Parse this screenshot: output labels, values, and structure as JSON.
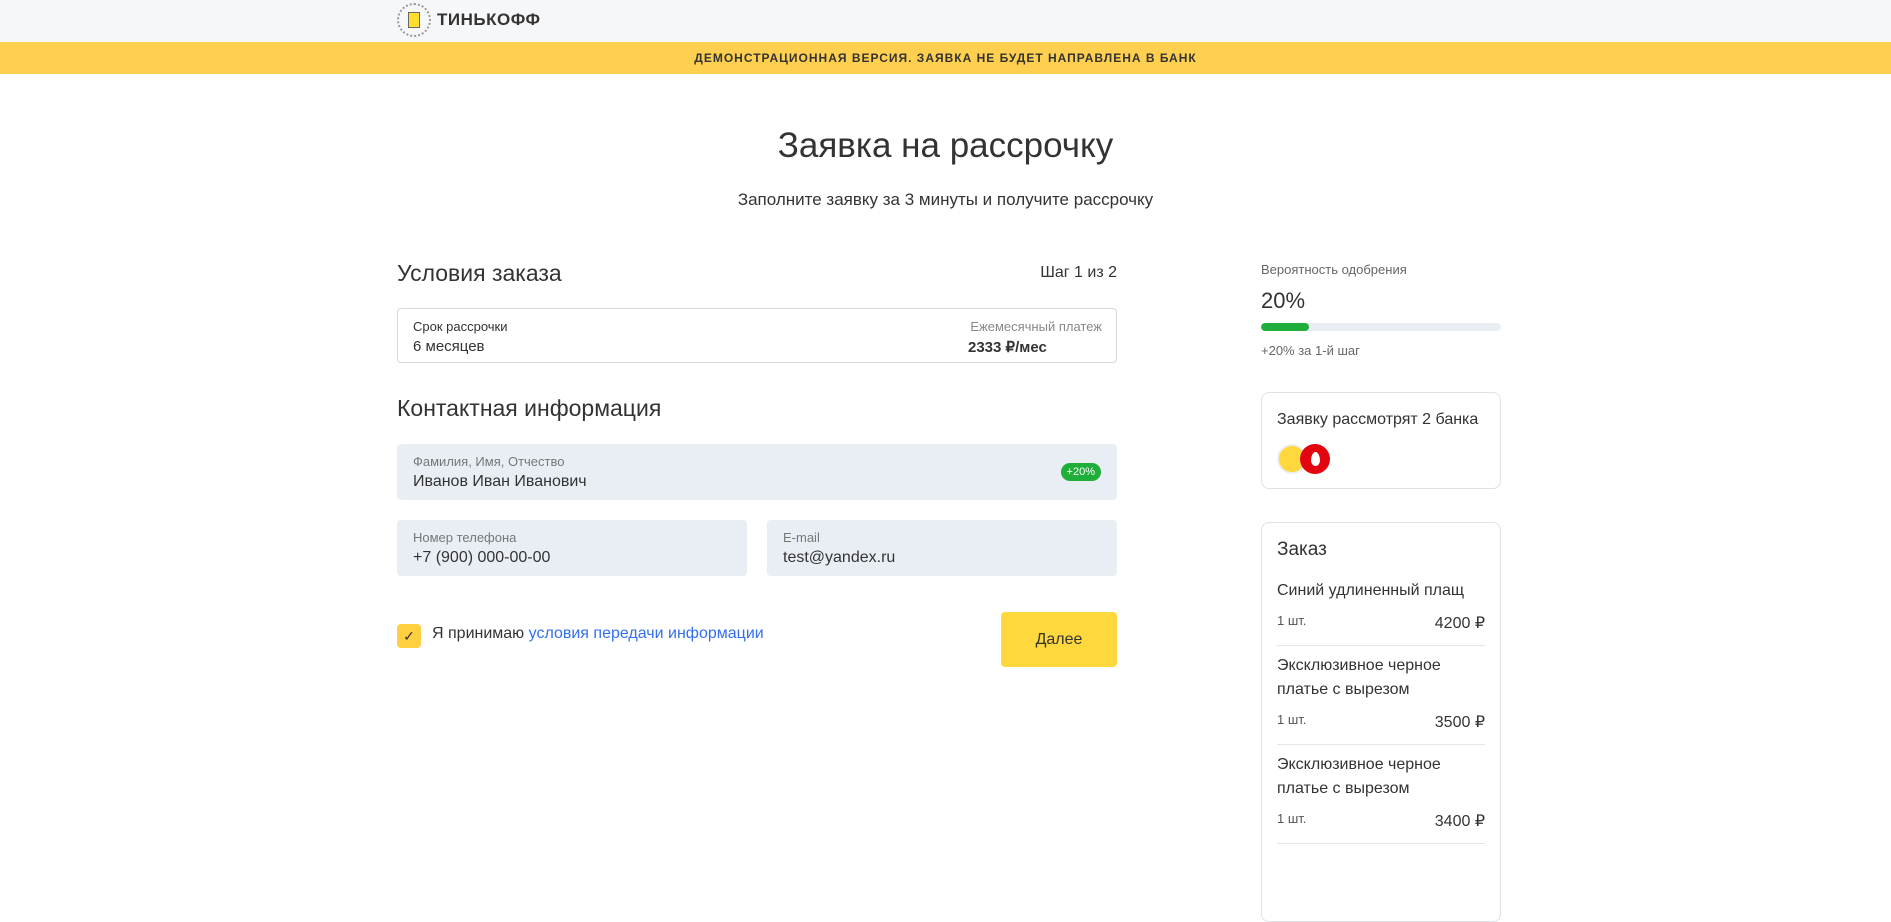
{
  "header": {
    "logo_text": "ТИНЬКОФФ"
  },
  "banner": "ДЕМОНСТРАЦИОННАЯ ВЕРСИЯ. ЗАЯВКА НЕ БУДЕТ НАПРАВЛЕНА В БАНК",
  "title": "Заявка на рассрочку",
  "subtitle": "Заполните заявку за 3 минуты и получите рассрочку",
  "conditions": {
    "heading": "Условия заказа",
    "step": "Шаг 1 из 2",
    "term_label": "Срок рассрочки",
    "term_value": "6 месяцев",
    "payment_label": "Ежемесячный платеж",
    "payment_value": "2333 ₽/мес"
  },
  "contact": {
    "heading": "Контактная информация",
    "name": {
      "label": "Фамилия, Имя, Отчество",
      "value": "Иванов Иван Иванович",
      "badge": "+20%"
    },
    "phone": {
      "label": "Номер телефона",
      "value": "+7 (900) 000-00-00"
    },
    "email": {
      "label": "E-mail",
      "value": "test@yandex.ru"
    }
  },
  "agree": {
    "text": "Я принимаю ",
    "link": "условия передачи информации",
    "checked": true
  },
  "next_button": "Далее",
  "approval": {
    "label": "Вероятность одобрения",
    "value": "20%",
    "progress_percent": 20,
    "hint": "+20% за 1-й шаг"
  },
  "banks": {
    "title": "Заявку рассмотрят 2 банка"
  },
  "order": {
    "title": "Заказ",
    "items": [
      {
        "name": "Синий удлиненный плащ",
        "qty": "1 шт.",
        "price": "4200 ₽"
      },
      {
        "name": "Эксклюзивное черное платье с вырезом",
        "qty": "1 шт.",
        "price": "3500 ₽"
      },
      {
        "name": "Эксклюзивное черное платье с вырезом",
        "qty": "1 шт.",
        "price": "3400 ₽"
      }
    ]
  },
  "colors": {
    "accent": "#ffdd2d",
    "banner": "#ffcf50",
    "green": "#1fae3a",
    "link": "#336fee"
  }
}
